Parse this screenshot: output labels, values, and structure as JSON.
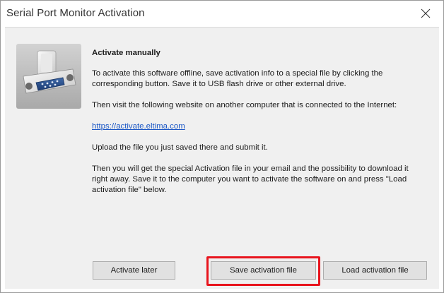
{
  "window": {
    "title": "Serial Port Monitor Activation",
    "close_icon": "close-icon"
  },
  "content": {
    "icon": "serial-port-icon",
    "heading": "Activate manually",
    "paragraph1": "To activate this software offline, save activation info to a special file by clicking the corresponding button. Save it to USB flash drive or other external drive.",
    "paragraph2": "Then visit the following website on another computer that is connected to the Internet:",
    "link": "https://activate.eltima.com",
    "paragraph3": "Upload the file you just saved there and submit it.",
    "paragraph4": "Then you will get the special Activation file in your email and the possibility to download it right away. Save it to the computer you want to activate the software on and press \"Load activation file\" below."
  },
  "buttons": {
    "activate_later": "Activate later",
    "save_activation": "Save activation file",
    "load_activation": "Load activation file"
  },
  "colors": {
    "highlight": "#e8141d",
    "link": "#1a56c5"
  }
}
